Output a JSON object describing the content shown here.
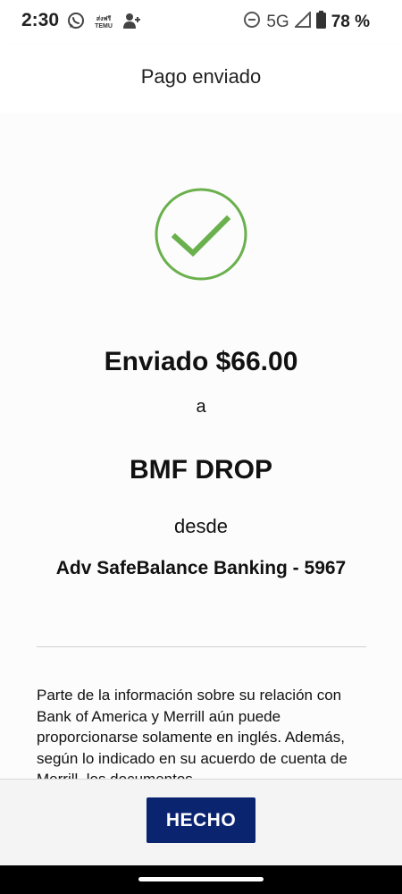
{
  "status_bar": {
    "time": "2:30",
    "temu_line1": "ส่งฟรี",
    "temu_line2": "TEMU",
    "network": "5G",
    "battery": "78 %",
    "icons": [
      "whatsapp-icon",
      "person-add-icon",
      "do-not-disturb-icon",
      "signal-icon",
      "battery-icon"
    ]
  },
  "header": {
    "title": "Pago enviado"
  },
  "confirmation": {
    "sent_amount": "Enviado $66.00",
    "to_word": "a",
    "recipient": "BMF DROP",
    "from_word": "desde",
    "account": "Adv SafeBalance Banking - 5967",
    "check_color": "#6ab04c"
  },
  "disclaimer": {
    "text": "Parte de la información sobre su relación con Bank of America y Merrill aún puede proporcionarse solamente en inglés. Además, según lo indicado en su acuerdo de cuenta de Merrill, los documentos"
  },
  "footer": {
    "done_label": "HECHO",
    "button_color": "#0b2470"
  }
}
